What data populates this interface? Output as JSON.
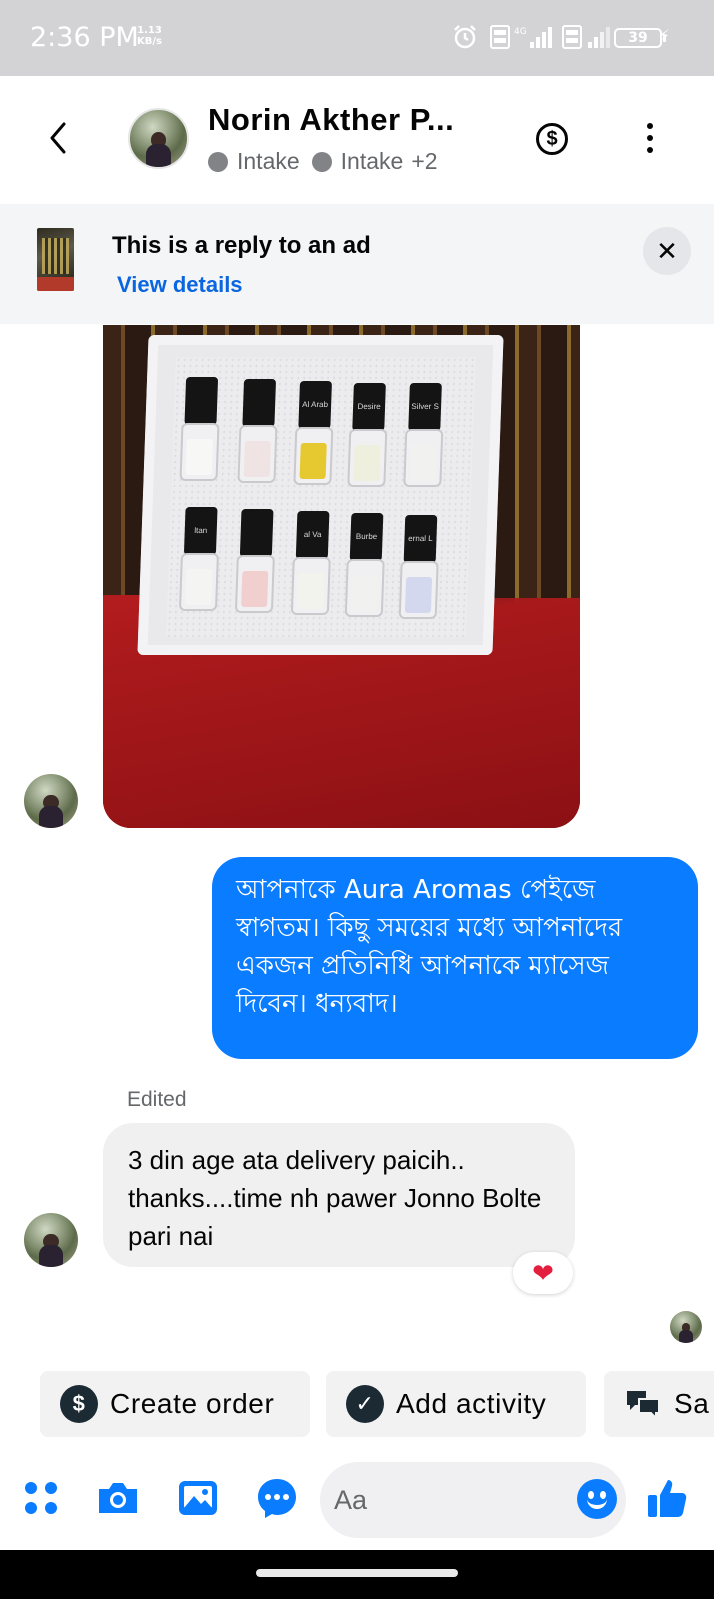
{
  "status_bar": {
    "time": "2:36 PM",
    "net_speed_value": "1.13",
    "net_speed_unit": "KB/s",
    "battery": "39",
    "icons": [
      "alarm-icon",
      "volte-icon",
      "signal-icon",
      "volte-icon",
      "signal-icon",
      "battery-icon",
      "charging-icon"
    ]
  },
  "header": {
    "contact_name": "Norin Akther P...",
    "labels": [
      "Intake",
      "Intake"
    ],
    "labels_more": "+2",
    "back_icon": "chevron-left-icon",
    "dollar_icon": "dollar-icon",
    "more_icon": "more-vertical-icon"
  },
  "ad_banner": {
    "title": "This is a reply to an ad",
    "link": "View details",
    "close_icon": "close-icon"
  },
  "photo_message": {
    "bottle_labels_top": [
      "",
      "",
      "Al Arab",
      "Desire",
      "Silver S"
    ],
    "bottle_labels_bottom": [
      "ltan",
      "",
      "al Va",
      "Burbe",
      "ernal L"
    ]
  },
  "messages": {
    "outgoing_text": "আপনাকে Aura Aromas পেইজে স্বাগতম। কিছু সময়ের মধ্যে আপনাদের একজন প্রতিনিধি আপনাকে ম্যাসেজ দিবেন। ধন্যবাদ।",
    "edited_label": "Edited",
    "incoming_text": "3 din age ata delivery paicih.. thanks....time nh pawer Jonno Bolte pari nai",
    "reaction": "❤"
  },
  "quick_actions": [
    {
      "label": "Create order",
      "icon": "dollar-circle-icon"
    },
    {
      "label": "Add activity",
      "icon": "check-circle-icon"
    },
    {
      "label": "Sa",
      "icon": "chat-bubbles-icon"
    }
  ],
  "composer": {
    "placeholder": "Aa",
    "icons": [
      "apps-icon",
      "camera-icon",
      "gallery-icon",
      "chat-extension-icon",
      "emoji-icon",
      "thumbs-up-icon"
    ]
  },
  "colors": {
    "accent": "#0a7cff",
    "link": "#0a66e0",
    "status_bar": "#d3d3d5",
    "incoming_bubble": "#f0f0f0",
    "reaction_heart": "#e41e3f"
  }
}
